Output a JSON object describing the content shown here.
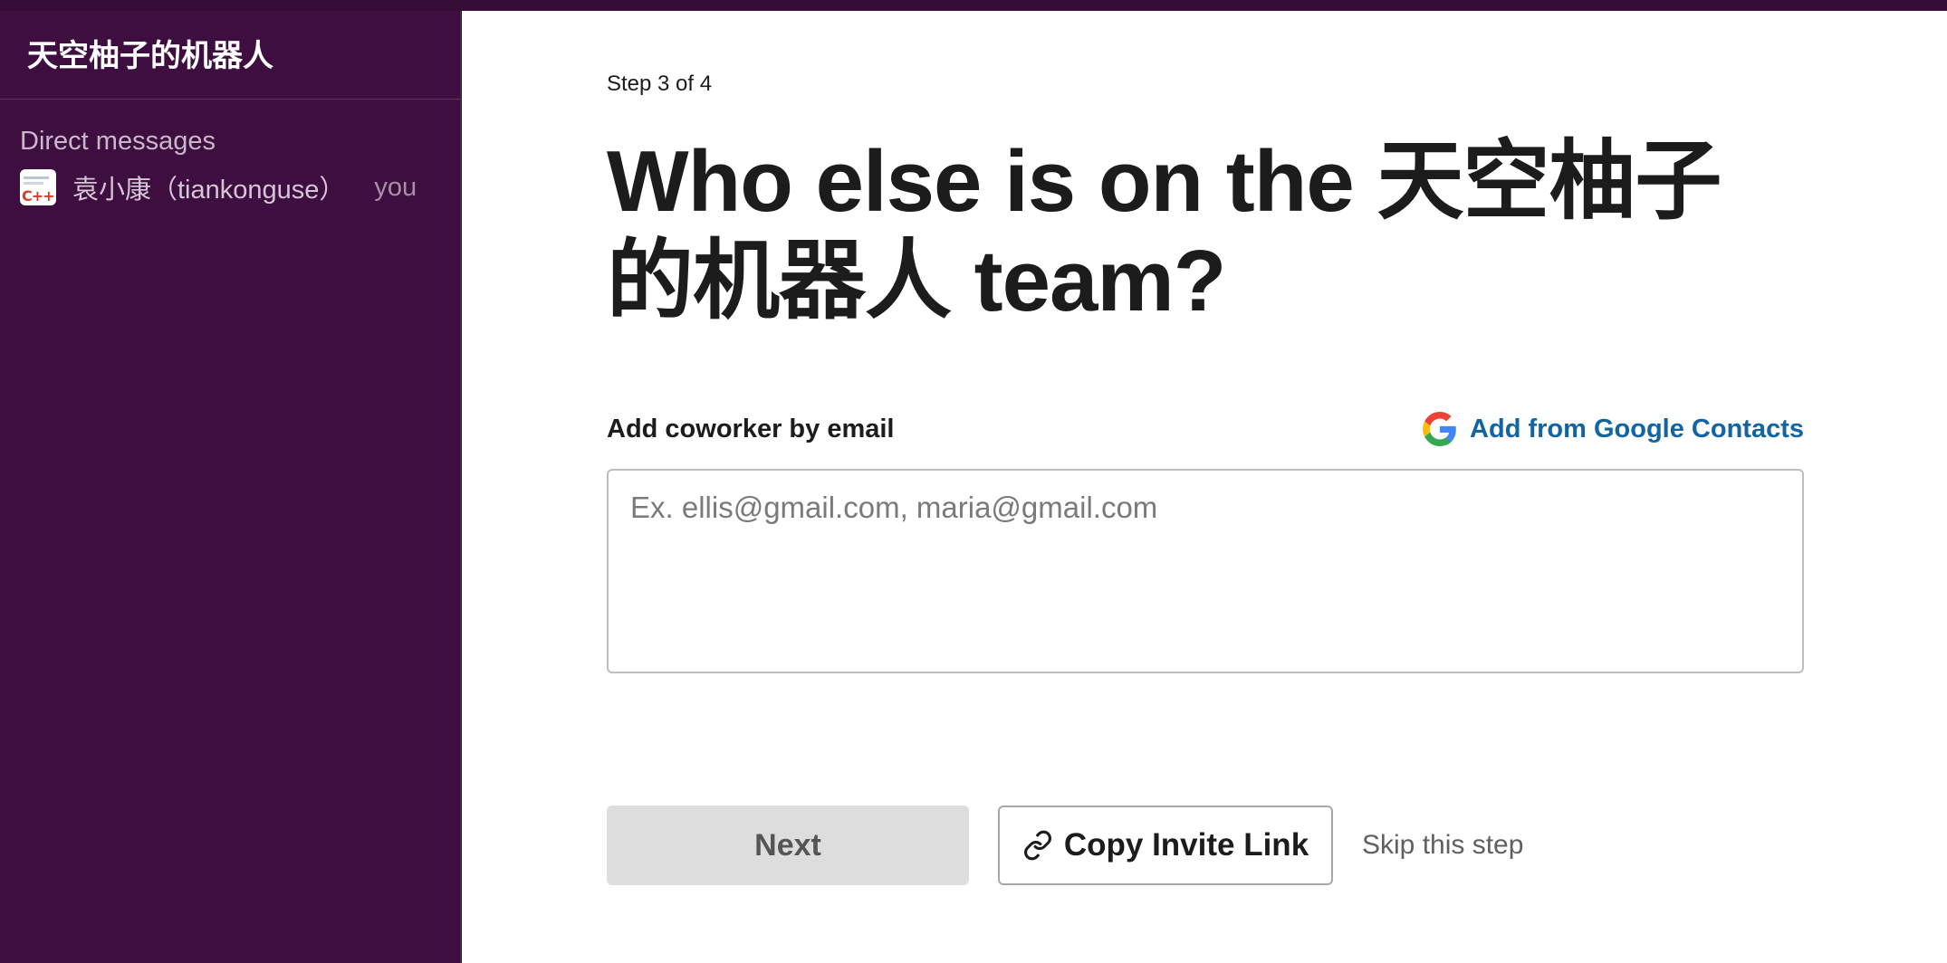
{
  "sidebar": {
    "workspace_name": "天空柚子的机器人",
    "section_title": "Direct messages",
    "dm": {
      "name": "袁小康（tiankonguse）",
      "you_label": "you"
    }
  },
  "main": {
    "step": "Step 3 of 4",
    "title": "Who else is on the 天空柚子的机器人 team?",
    "email_label": "Add coworker by email",
    "google_link": "Add from Google Contacts",
    "email_placeholder": "Ex. ellis@gmail.com, maria@gmail.com",
    "email_value": "",
    "next_label": "Next",
    "copy_label": "Copy Invite Link",
    "skip_label": "Skip this step"
  },
  "colors": {
    "sidebar_bg": "#3f0e40",
    "link_blue": "#1264a3",
    "next_disabled_bg": "#dddddd"
  },
  "icons": {
    "google": "google-g-icon",
    "link": "link-icon"
  }
}
